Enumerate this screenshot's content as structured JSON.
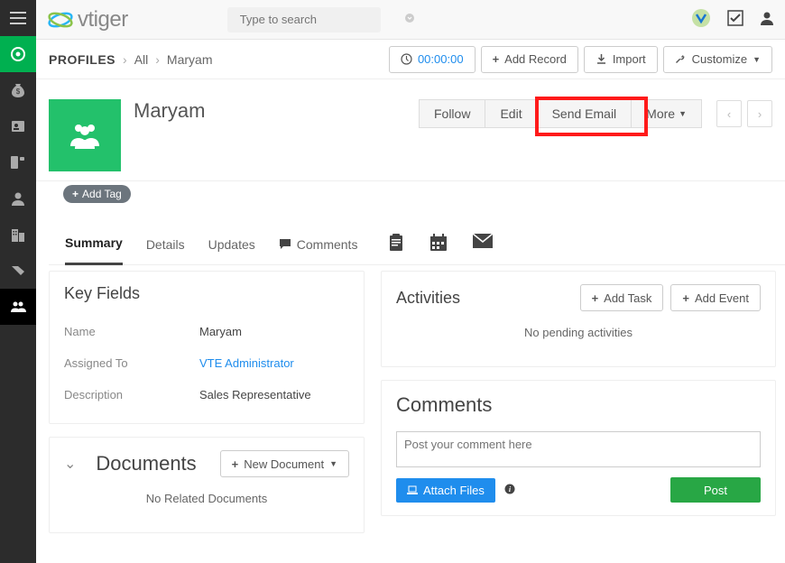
{
  "brand": {
    "name": "vtiger"
  },
  "search": {
    "placeholder": "Type to search"
  },
  "subheader": {
    "module": "PROFILES",
    "crumb_all": "All",
    "crumb_record": "Maryam",
    "timer": "00:00:00",
    "add_record": "Add Record",
    "import": "Import",
    "customize": "Customize"
  },
  "hero": {
    "title": "Maryam",
    "follow": "Follow",
    "edit": "Edit",
    "send_email": "Send Email",
    "more": "More",
    "add_tag": "Add Tag"
  },
  "tabs": {
    "summary": "Summary",
    "details": "Details",
    "updates": "Updates",
    "comments": "Comments"
  },
  "key_fields": {
    "title": "Key Fields",
    "rows": [
      {
        "label": "Name",
        "value": "Maryam",
        "link": false
      },
      {
        "label": "Assigned To",
        "value": "VTE Administrator",
        "link": true
      },
      {
        "label": "Description",
        "value": "Sales Representative",
        "link": false
      }
    ]
  },
  "documents": {
    "title": "Documents",
    "new_document": "New Document",
    "empty": "No Related Documents"
  },
  "activities": {
    "title": "Activities",
    "add_task": "Add Task",
    "add_event": "Add Event",
    "empty": "No pending activities"
  },
  "comments": {
    "title": "Comments",
    "placeholder": "Post your comment here",
    "attach": "Attach Files",
    "post": "Post"
  }
}
